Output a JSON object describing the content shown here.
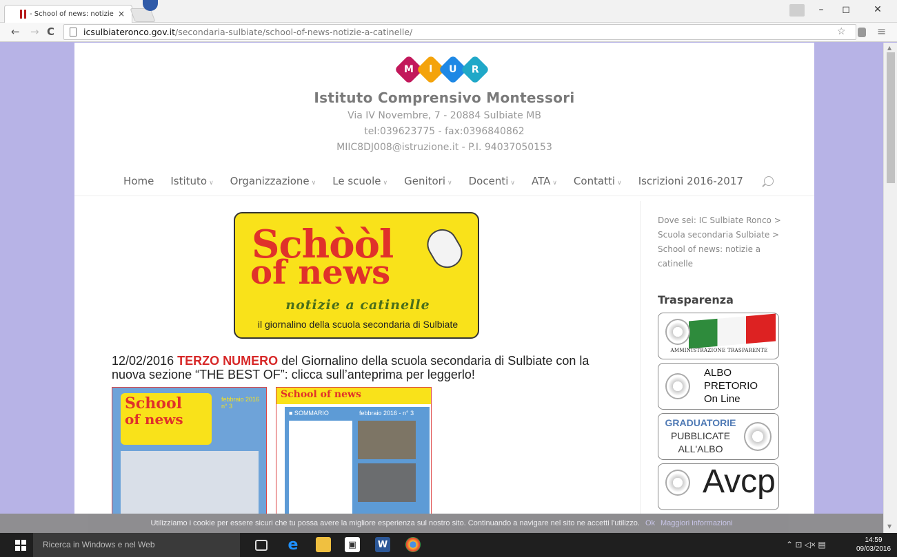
{
  "browser": {
    "tab_title": "- School of news: notizie",
    "tab_close": "×",
    "url_host": "icsulbiateronco.gov.it",
    "url_path": "/secondaria-sulbiate/school-of-news-notizie-a-catinelle/",
    "nav_back": "←",
    "nav_forward": "→",
    "nav_reload": "C",
    "win_minimize": "–",
    "win_restore": "◻",
    "win_close": "✕",
    "star_icon": "☆",
    "menu_icon": "≡"
  },
  "site": {
    "logo_letters": [
      "M",
      "I",
      "U",
      "R"
    ],
    "logo_colors": [
      "#c2185b",
      "#f4a30b",
      "#1e88e5",
      "#20a8c8"
    ],
    "name": "Istituto Comprensivo Montessori",
    "address": "Via IV Novembre, 7 - 20884 Sulbiate MB",
    "phone": "tel:039623775 - fax:0396840862",
    "email": "MIIC8DJ008@istruzione.it - P.I. 94037050153"
  },
  "menu": [
    {
      "label": "Home",
      "dropdown": false
    },
    {
      "label": "Istituto",
      "dropdown": true
    },
    {
      "label": "Organizzazione",
      "dropdown": true
    },
    {
      "label": "Le scuole",
      "dropdown": true
    },
    {
      "label": "Genitori",
      "dropdown": true
    },
    {
      "label": "Docenti",
      "dropdown": true
    },
    {
      "label": "ATA",
      "dropdown": true
    },
    {
      "label": "Contatti",
      "dropdown": true
    },
    {
      "label": "Iscrizioni 2016-2017",
      "dropdown": false
    }
  ],
  "banner": {
    "school": "Schòòl",
    "news": "of news",
    "subtitle": "notizie a catinelle",
    "tagline": "il giornalino della scuola secondaria di Sulbiate"
  },
  "article": {
    "date": "12/02/2016",
    "highlight": "TERZO NUMERO",
    "rest": " del Giornalino della scuola secondaria di Sulbiate con la nuova sezione “THE BEST OF”: clicca sull’anteprima per leggerlo!"
  },
  "thumbs": {
    "cover_school": "School",
    "cover_news": "of news",
    "cover_date": "febbraio 2016 n° 3",
    "page_title": "School of news",
    "sommario": "■ SOMMARIO",
    "issue": "febbraio 2016 - n° 3"
  },
  "sidebar": {
    "breadcrumb": "Dove sei: IC Sulbiate Ronco > Scuola secondaria Sulbiate > School of news: notizie a catinelle",
    "title": "Trasparenza",
    "amministrazione": "AMMINISTRAZIONE TRASPARENTE",
    "albo_line1": "ALBO",
    "albo_line2": "PRETORIO",
    "albo_line3": "On Line",
    "grad_line1": "GRADUATORIE",
    "grad_line2": "PUBBLICATE",
    "grad_line3": "ALL'ALBO",
    "avcp": "Avcp"
  },
  "cookie": {
    "text": "Utilizziamo i cookie per essere sicuri che tu possa avere la migliore esperienza sul nostro sito. Continuando a navigare nel sito ne accetti l'utilizzo.",
    "ok": "Ok",
    "more": "Maggiori informazioni"
  },
  "taskbar": {
    "search_placeholder": "Ricerca in Windows e nel Web",
    "time": "14:59",
    "date": "09/03/2016"
  }
}
